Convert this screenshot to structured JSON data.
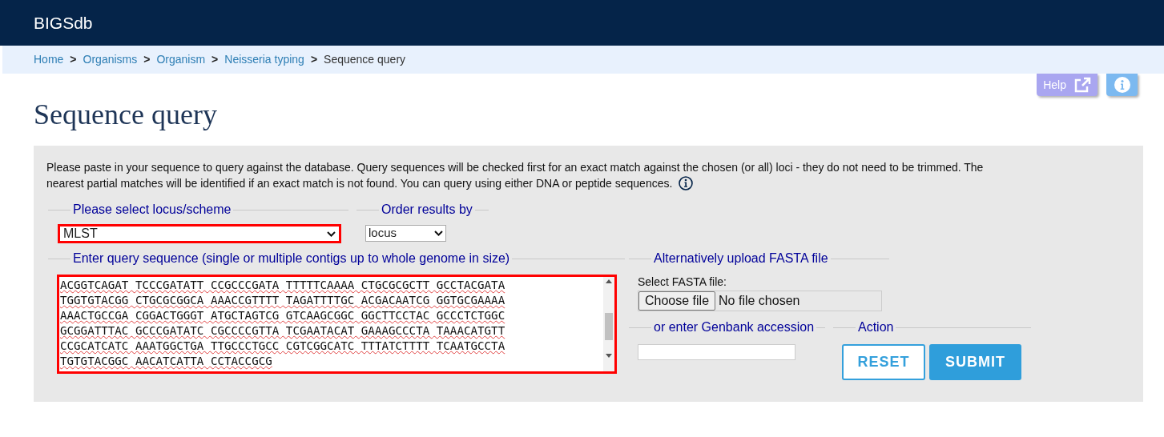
{
  "header": {
    "title": "BIGSdb"
  },
  "breadcrumb": [
    {
      "label": "Home",
      "link": true
    },
    {
      "label": "Organisms",
      "link": true
    },
    {
      "label": "Organism",
      "link": true
    },
    {
      "label": "Neisseria typing",
      "link": true
    },
    {
      "label": "Sequence query",
      "link": false
    }
  ],
  "breadcrumb_separator": ">",
  "toolbar": {
    "help": "Help"
  },
  "page_title": "Sequence query",
  "intro": "Please paste in your sequence to query against the database. Query sequences will be checked first for an exact match against the chosen (or all) loci - they do not need to be trimmed. The nearest partial matches will be identified if an exact match is not found. You can query using either DNA or peptide sequences.",
  "locus": {
    "legend": "Please select locus/scheme",
    "value": "MLST",
    "error": true
  },
  "order": {
    "legend": "Order results by",
    "value": "locus"
  },
  "sequence": {
    "legend": "Enter query sequence (single or multiple contigs up to whole genome in size)",
    "error": true,
    "lines": [
      "ACGGTCAGAT TCCCGATATT CCGCCCGATA TTTTTCAAAA CTGCGCGCTT GCCTACGATA",
      "TGGTGTACGG CTGCGCGGCA AAACCGTTTT TAGATTTTGC ACGACAATCG GGTGCGAAAA",
      "AAACTGCCGA CGGACTGGGT ATGCTAGTCG GTCAAGCGGC GGCTTCCTAC GCCCTCTGGC",
      "GCGGATTTAC GCCCGATATC CGCCCCGTTA TCGAATACAT GAAAGCCCTA TAAACATGTT",
      "CCGCATCATC AAATGGCTGA TTGCCCTGCC CGTCGGCATC TTTATCTTTT TCAATGCCTA",
      "TGTGTACGGC AACATCATTA CCTACCGCG"
    ]
  },
  "upload": {
    "legend": "Alternatively upload FASTA file",
    "label": "Select FASTA file:",
    "button": "Choose file",
    "status": "No file chosen"
  },
  "genbank": {
    "legend": "or enter Genbank accession"
  },
  "action": {
    "legend": "Action",
    "reset": "RESET",
    "submit": "SUBMIT"
  }
}
